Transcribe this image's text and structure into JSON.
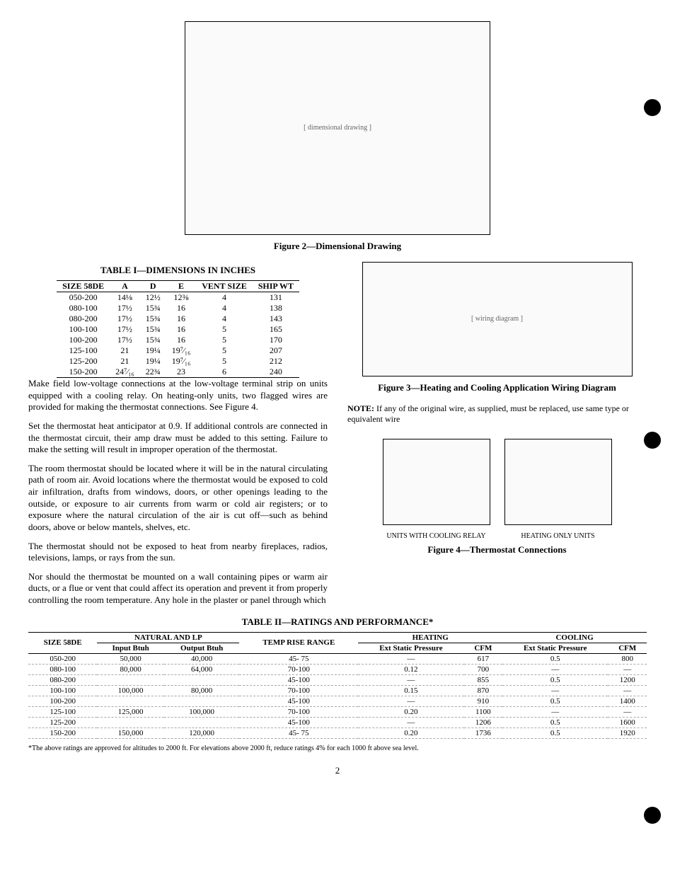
{
  "figure2": {
    "title": "Figure 2—Dimensional Drawing"
  },
  "table1": {
    "title": "TABLE I—DIMENSIONS IN INCHES",
    "headers": [
      "SIZE 58DE",
      "A",
      "D",
      "E",
      "VENT SIZE",
      "SHIP WT"
    ],
    "rows": [
      [
        "050-200",
        "14⅛",
        "12½",
        "12⅜",
        "4",
        "131"
      ],
      [
        "080-100",
        "17½",
        "15¾",
        "16",
        "4",
        "138"
      ],
      [
        "080-200",
        "17½",
        "15¾",
        "16",
        "4",
        "143"
      ],
      [
        "100-100",
        "17½",
        "15¾",
        "16",
        "5",
        "165"
      ],
      [
        "100-200",
        "17½",
        "15¾",
        "16",
        "5",
        "170"
      ],
      [
        "125-100",
        "21",
        "19¼",
        "19⁷⁄₁₆",
        "5",
        "207"
      ],
      [
        "125-200",
        "21",
        "19¼",
        "19⁷⁄₁₆",
        "5",
        "212"
      ],
      [
        "150-200",
        "24⁷⁄₁₆",
        "22¾",
        "23",
        "6",
        "240"
      ]
    ]
  },
  "body": {
    "p1": "Make field low-voltage connections at the low-voltage terminal strip on units equipped with a cooling relay. On heating-only units, two flagged wires are provided for making the thermostat connections. See Figure 4.",
    "p2": "Set the thermostat heat anticipator at 0.9. If additional controls are connected in the thermostat circuit, their amp draw must be added to this setting. Failure to make the setting will result in improper operation of the thermostat.",
    "p3": "The room thermostat should be located where it will be in the natural circulating path of room air. Avoid locations where the thermostat would be exposed to cold air infiltration, drafts from windows, doors, or other openings leading to the outside, or exposure to air currents from warm or cold air registers; or to exposure where the natural circulation of the air is cut off—such as behind doors, above or below mantels, shelves, etc.",
    "p4": "The thermostat should not be exposed to heat from nearby fireplaces, radios, televisions, lamps, or rays from the sun.",
    "p5": "Nor should the thermostat be mounted on a wall containing pipes or warm air ducts, or a flue or vent that could affect its operation and prevent it from properly controlling the room temperature. Any hole in the plaster or panel through which"
  },
  "figure3": {
    "title": "Figure 3—Heating and Cooling Application Wiring Diagram",
    "note_label": "NOTE:",
    "note": "If any of the original wire, as supplied, must be replaced, use same type or equivalent wire"
  },
  "figure4": {
    "left_label": "UNITS WITH COOLING RELAY",
    "right_label": "HEATING ONLY UNITS",
    "title": "Figure 4—Thermostat Connections"
  },
  "table2": {
    "title": "TABLE II—RATINGS AND PERFORMANCE*",
    "group_headers": [
      "SIZE 58DE",
      "NATURAL AND LP",
      "TEMP RISE RANGE",
      "HEATING",
      "COOLING"
    ],
    "sub_headers": [
      "",
      "Input Btuh",
      "Output Btuh",
      "",
      "Ext Static Pressure",
      "CFM",
      "Ext Static Pressure",
      "CFM"
    ],
    "rows": [
      {
        "size": "050-200",
        "in": "50,000",
        "out": "40,000",
        "rise": "45- 75",
        "hesp": "—",
        "hcfm": "617",
        "cesp": "0.5",
        "ccfm": "800"
      },
      {
        "size": "080-100",
        "in": "80,000",
        "out": "64,000",
        "rise": "70-100",
        "hesp": "0.12",
        "hcfm": "700",
        "cesp": "—",
        "ccfm": "—"
      },
      {
        "size": "080-200",
        "in": "",
        "out": "",
        "rise": "45-100",
        "hesp": "—",
        "hcfm": "855",
        "cesp": "0.5",
        "ccfm": "1200"
      },
      {
        "size": "100-100",
        "in": "100,000",
        "out": "80,000",
        "rise": "70-100",
        "hesp": "0.15",
        "hcfm": "870",
        "cesp": "—",
        "ccfm": "—"
      },
      {
        "size": "100-200",
        "in": "",
        "out": "",
        "rise": "45-100",
        "hesp": "—",
        "hcfm": "910",
        "cesp": "0.5",
        "ccfm": "1400"
      },
      {
        "size": "125-100",
        "in": "125,000",
        "out": "100,000",
        "rise": "70-100",
        "hesp": "0.20",
        "hcfm": "1100",
        "cesp": "—",
        "ccfm": "—"
      },
      {
        "size": "125-200",
        "in": "",
        "out": "",
        "rise": "45-100",
        "hesp": "—",
        "hcfm": "1206",
        "cesp": "0.5",
        "ccfm": "1600"
      },
      {
        "size": "150-200",
        "in": "150,000",
        "out": "120,000",
        "rise": "45- 75",
        "hesp": "0.20",
        "hcfm": "1736",
        "cesp": "0.5",
        "ccfm": "1920"
      }
    ],
    "footnote": "*The above ratings are approved for altitudes to 2000 ft. For elevations above 2000 ft, reduce ratings 4% for each 1000 ft above sea level."
  },
  "page": "2"
}
